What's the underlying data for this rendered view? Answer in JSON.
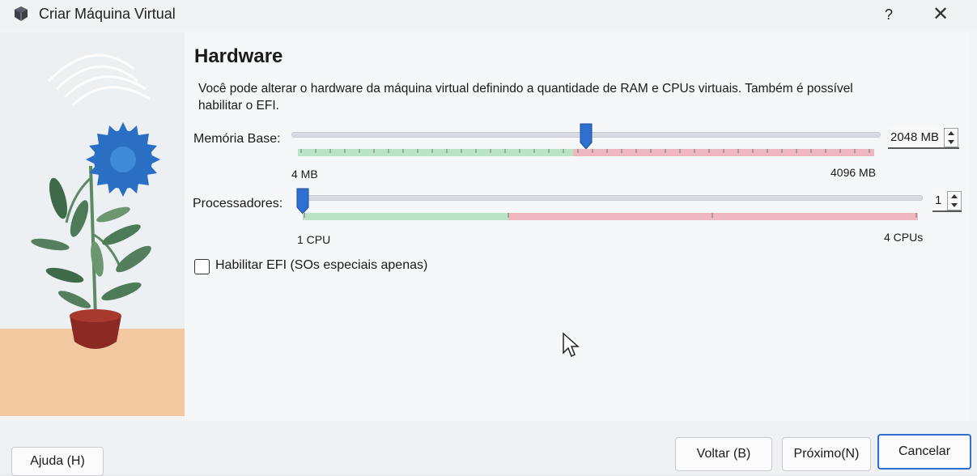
{
  "window": {
    "title": "Criar Máquina Virtual",
    "help_label": "?",
    "close_label": "✕"
  },
  "page": {
    "heading": "Hardware",
    "description": "Você pode alterar o hardware da máquina virtual definindo a quantidade de RAM e CPUs virtuais. Também é possível habilitar o EFI."
  },
  "memory": {
    "label": "Memória Base:",
    "min_label": "4 MB",
    "max_label": "4096 MB",
    "value": "2048 MB",
    "value_fraction": 0.5
  },
  "processors": {
    "label": "Processadores:",
    "min_label": "1 CPU",
    "max_label": "4 CPUs",
    "value": "1",
    "value_fraction": 0.0
  },
  "efi": {
    "label": "Habilitar EFI (SOs especiais apenas)",
    "checked": false
  },
  "buttons": {
    "help": "Ajuda (H)",
    "back": "Voltar (B)",
    "next": "Próximo(N)",
    "cancel": "Cancelar"
  },
  "colors": {
    "accent": "#2f6fd0",
    "ok_zone": "#b9e2c6",
    "warn_zone": "#efb7c0"
  }
}
